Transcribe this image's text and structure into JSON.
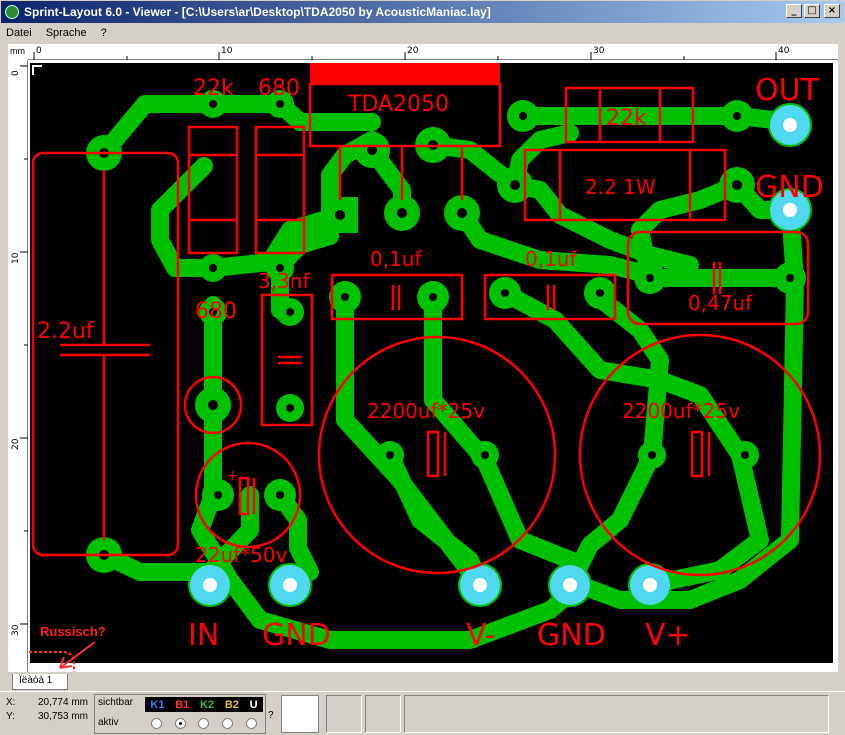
{
  "window": {
    "title": "Sprint-Layout 6.0 - Viewer - [C:\\Users\\ar\\Desktop\\TDA2050 by AcousticManiac.lay]",
    "min": "_",
    "max": "□",
    "close": "×"
  },
  "menu": {
    "items": [
      "Datei",
      "Sprache",
      "?"
    ]
  },
  "ruler": {
    "unit": "mm",
    "top_ticks": [
      "0",
      "10",
      "20",
      "30",
      "40"
    ],
    "left_ticks": [
      "0",
      "10",
      "20",
      "30"
    ]
  },
  "colors": {
    "board": "#000000",
    "copper": "#00c000",
    "silk": "#ff0000",
    "pad_hole": "#50d8f0"
  },
  "board": {
    "labels": {
      "r1": "22k",
      "r2": "680",
      "ic": "TDA2050",
      "r3": "22k",
      "r4": "2.2 1W",
      "out": "OUT",
      "gnd_top": "GND",
      "c_2u2": "2.2uf",
      "c_3n3": "3,3nf",
      "r5": "680",
      "c_01a": "0,1uf",
      "c_01b": "0,1uf",
      "c_047": "0,47uf",
      "c_2200a": "2200uf*25v",
      "c_2200b": "2200uf*25v",
      "c_22u": "22uf*50v",
      "in": "IN",
      "gnd_in": "GND",
      "vminus": "V-",
      "gnd_pwr": "GND",
      "vplus": "V+"
    }
  },
  "annotation": {
    "text": "Russisch?"
  },
  "tabs": {
    "layer_tab": "Ïëàòà 1"
  },
  "status": {
    "x_label": "X:",
    "x_value": "20,774 mm",
    "y_label": "Y:",
    "y_value": "30,753 mm",
    "sichtbar": "sichtbar",
    "aktiv": "aktiv",
    "layers": [
      "K1",
      "B1",
      "K2",
      "B2",
      "U"
    ],
    "layer_colors": [
      "#3a7bff",
      "#ff3030",
      "#30c030",
      "#e0c020",
      "#ffffff"
    ],
    "active_layer_index": 1,
    "question": "?"
  }
}
